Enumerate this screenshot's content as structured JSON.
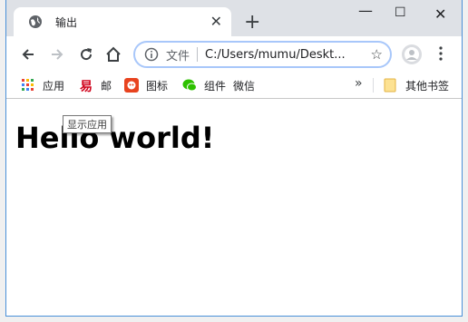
{
  "tab": {
    "title": "输出",
    "close_glyph": "✕",
    "icon": "globe-icon"
  },
  "newtab_glyph": "+",
  "window_controls": {
    "minimize": "—",
    "maximize": "☐",
    "close": "✕"
  },
  "toolbar": {
    "back_icon": "back-arrow-icon",
    "forward_icon": "forward-arrow-icon",
    "reload_icon": "reload-icon",
    "home_icon": "home-icon"
  },
  "omnibox": {
    "site_label": "文件",
    "url": "C:/Users/mumu/Deskt...",
    "star_glyph": "☆"
  },
  "bookmarks": {
    "items": [
      {
        "label": "应用",
        "icon": "apps-grid-icon"
      },
      {
        "label": "邮",
        "icon": "mail-icon"
      },
      {
        "label": "图标",
        "icon": "icon-site-icon"
      },
      {
        "label": "组件",
        "icon": "wechat-icon"
      },
      {
        "label": "微信",
        "icon": ""
      }
    ],
    "overflow_glyph": "»",
    "other_label": "其他书签"
  },
  "page": {
    "heading": "Hello world!",
    "tooltip": "显示应用"
  },
  "colors": {
    "focus_ring": "#a8c7fa",
    "frame": "#dee1e6",
    "window_border": "#4a90d9"
  }
}
